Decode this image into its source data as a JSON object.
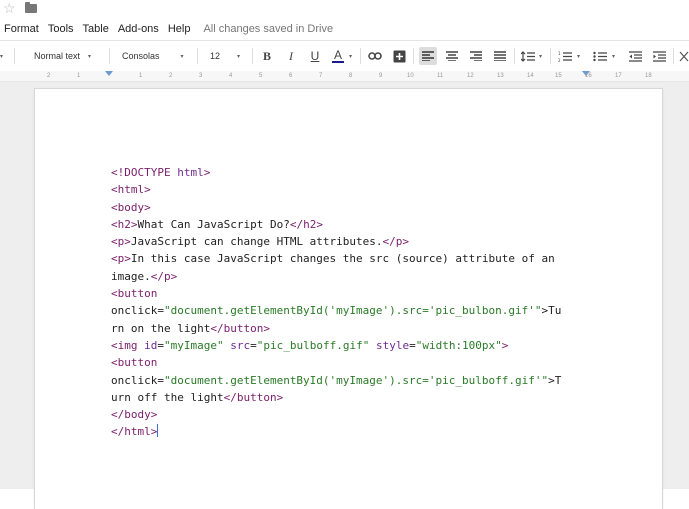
{
  "menu": {
    "items": [
      "Format",
      "Tools",
      "Table",
      "Add-ons",
      "Help"
    ],
    "status": "All changes saved in Drive"
  },
  "toolbar": {
    "style": "Normal text",
    "font": "Consolas",
    "size": "12",
    "bold": "B",
    "italic": "I",
    "underline": "U",
    "text_color": "A"
  },
  "ruler": {
    "ticks": [
      "2",
      "1",
      "1",
      "2",
      "3",
      "4",
      "5",
      "6",
      "7",
      "8",
      "9",
      "10",
      "11",
      "12",
      "13",
      "14",
      "15",
      "16",
      "17",
      "18"
    ]
  },
  "document": {
    "lines": [
      "<!DOCTYPE html>",
      "<html>",
      "<body>",
      "<h2>What Can JavaScript Do?</h2>",
      "<p>JavaScript can change HTML attributes.</p>",
      "<p>In this case JavaScript changes the src (source) attribute of an",
      "image.</p>",
      "<button",
      "onclick=\"document.getElementById('myImage').src='pic_bulbon.gif'\">Tu",
      "rn on the light</button>",
      "<img id=\"myImage\" src=\"pic_bulboff.gif\" style=\"width:100px\">",
      "<button",
      "onclick=\"document.getElementById('myImage').src='pic_bulboff.gif'\">T",
      "urn off the light</button>",
      "</body>",
      "</html>"
    ]
  },
  "colors": {
    "tag": "#7a1e6b",
    "attribute": "#6f2c91",
    "string": "#2a7b27",
    "cursor": "#3b6fd6"
  }
}
